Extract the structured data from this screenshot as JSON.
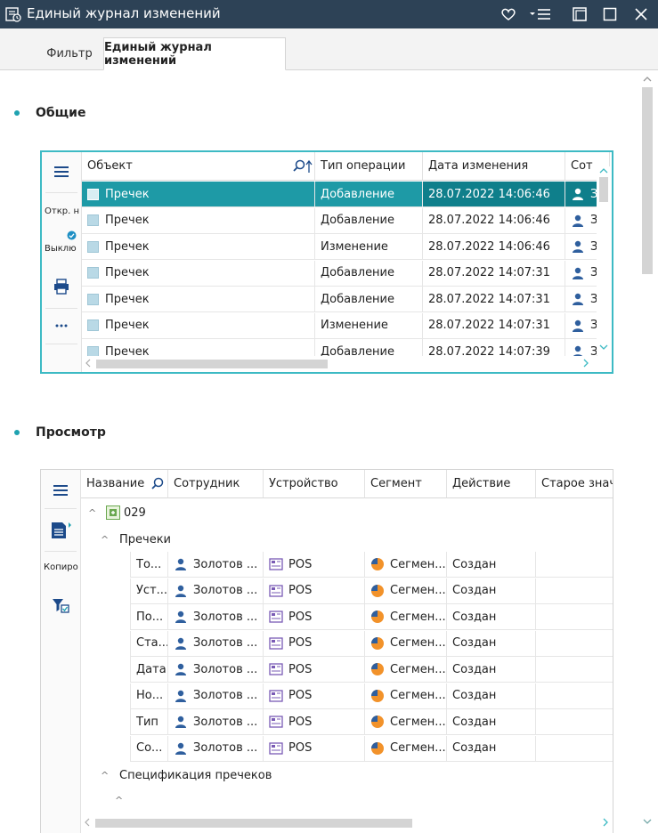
{
  "window": {
    "title": "Единый журнал изменений"
  },
  "tabs": [
    {
      "label": "Фильтр"
    },
    {
      "label": "Единый журнал изменений"
    }
  ],
  "sections": {
    "general": "Общие",
    "view": "Просмотр"
  },
  "table1": {
    "side": {
      "open_label": "Откр. н",
      "toggle_label": "Выклю"
    },
    "headers": [
      "Объект",
      "Тип операции",
      "Дата изменения",
      "Сот"
    ],
    "rows": [
      {
        "object": "Пречек",
        "op": "Добавление",
        "date": "28.07.2022 14:06:46",
        "emp": "З"
      },
      {
        "object": "Пречек",
        "op": "Добавление",
        "date": "28.07.2022 14:06:46",
        "emp": "З"
      },
      {
        "object": "Пречек",
        "op": "Изменение",
        "date": "28.07.2022 14:06:46",
        "emp": "З"
      },
      {
        "object": "Пречек",
        "op": "Добавление",
        "date": "28.07.2022 14:07:31",
        "emp": "З"
      },
      {
        "object": "Пречек",
        "op": "Добавление",
        "date": "28.07.2022 14:07:31",
        "emp": "З"
      },
      {
        "object": "Пречек",
        "op": "Изменение",
        "date": "28.07.2022 14:07:31",
        "emp": "З"
      },
      {
        "object": "Пречек",
        "op": "Добавление",
        "date": "28.07.2022 14:07:39",
        "emp": "З"
      }
    ]
  },
  "table2": {
    "side": {
      "copy_label": "Копиро"
    },
    "headers": [
      "Название",
      "Сотрудник",
      "Устройство",
      "Сегмент",
      "Действие",
      "Старое знач"
    ],
    "group": "029",
    "subgroup1": "Пречеки",
    "subgroup2": "Спецификация пречеков",
    "rows": [
      {
        "name": "То...",
        "emp": "Золотов ...",
        "device": "POS",
        "segment": "Сегмен...",
        "action": "Создан"
      },
      {
        "name": "Уст...",
        "emp": "Золотов ...",
        "device": "POS",
        "segment": "Сегмен...",
        "action": "Создан"
      },
      {
        "name": "По...",
        "emp": "Золотов ...",
        "device": "POS",
        "segment": "Сегмен...",
        "action": "Создан"
      },
      {
        "name": "Ста...",
        "emp": "Золотов ...",
        "device": "POS",
        "segment": "Сегмен...",
        "action": "Создан"
      },
      {
        "name": "Дата",
        "emp": "Золотов ...",
        "device": "POS",
        "segment": "Сегмен...",
        "action": "Создан"
      },
      {
        "name": "Но...",
        "emp": "Золотов ...",
        "device": "POS",
        "segment": "Сегмен...",
        "action": "Создан"
      },
      {
        "name": "Тип",
        "emp": "Золотов ...",
        "device": "POS",
        "segment": "Сегмен...",
        "action": "Создан"
      },
      {
        "name": "Со...",
        "emp": "Золотов ...",
        "device": "POS",
        "segment": "Сегмен...",
        "action": "Создан"
      }
    ]
  },
  "colors": {
    "titlebar": "#2d4256",
    "accent": "#1e9aa6",
    "selected_dark": "#0f7f8b",
    "icon_blue": "#2f5f9e",
    "segment_orange": "#f2922a"
  }
}
